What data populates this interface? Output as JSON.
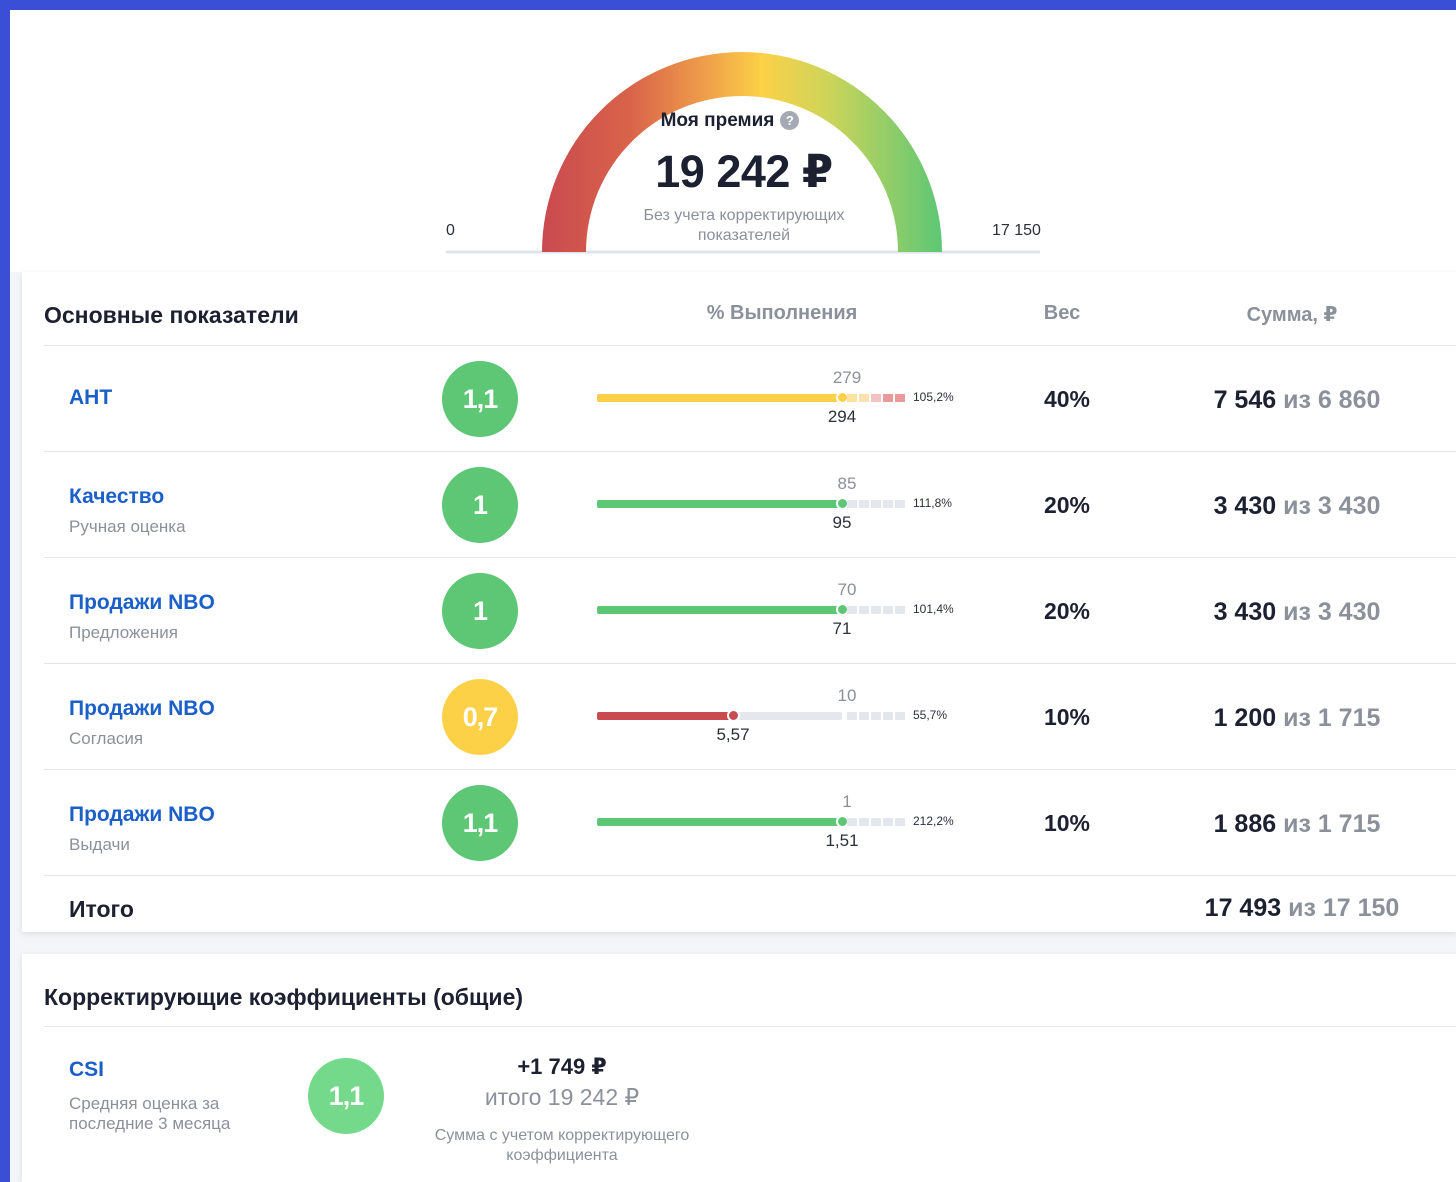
{
  "gauge": {
    "title": "Моя премия",
    "help_icon": "?",
    "value": "19 242 ₽",
    "note": "Без учета корректирующих показателей",
    "min_label": "0",
    "max_label": "17 150",
    "colors": [
      "#c94a4f",
      "#fcd147",
      "#5dc775"
    ]
  },
  "main": {
    "title": "Основные показатели",
    "headers": {
      "completion": "% Выполнения",
      "weight": "Вес",
      "sum": "Сумма, ₽"
    },
    "rows": [
      {
        "name": "АНТ",
        "sub": "",
        "coef": "1,1",
        "coef_color": "green",
        "plan": "279",
        "fact": "294",
        "pct": "105,2%",
        "fill": 1.0,
        "bar_color": "#fcd147",
        "weight": "40%",
        "sum": "7 546",
        "of": "из 6 860",
        "overflow": "red"
      },
      {
        "name": "Качество",
        "sub": "Ручная оценка",
        "coef": "1",
        "coef_color": "green",
        "plan": "85",
        "fact": "95",
        "pct": "111,8%",
        "fill": 1.0,
        "bar_color": "#5dc775",
        "weight": "20%",
        "sum": "3 430",
        "of": "из 3 430",
        "overflow": "grey"
      },
      {
        "name": "Продажи NBO",
        "sub": "Предложения",
        "coef": "1",
        "coef_color": "green",
        "plan": "70",
        "fact": "71",
        "pct": "101,4%",
        "fill": 1.0,
        "bar_color": "#5dc775",
        "weight": "20%",
        "sum": "3 430",
        "of": "из 3 430",
        "overflow": "grey"
      },
      {
        "name": "Продажи NBO",
        "sub": "Согласия",
        "coef": "0,7",
        "coef_color": "yellow",
        "plan": "10",
        "fact": "5,57",
        "pct": "55,7%",
        "fill": 0.557,
        "bar_color": "#c94a4f",
        "weight": "10%",
        "sum": "1 200",
        "of": "из 1 715",
        "overflow": "grey"
      },
      {
        "name": "Продажи NBO",
        "sub": "Выдачи",
        "coef": "1,1",
        "coef_color": "green",
        "plan": "1",
        "fact": "1,51",
        "pct": "212,2%",
        "fill": 1.0,
        "bar_color": "#5dc775",
        "weight": "10%",
        "sum": "1 886",
        "of": "из 1 715",
        "overflow": "grey"
      }
    ],
    "total_label": "Итого",
    "total_sum": "17 493",
    "total_of": "из 17 150"
  },
  "corrections": {
    "title": "Корректирующие коэффициенты (общие)",
    "item": {
      "name": "CSI",
      "sub": "Средняя оценка за последние 3 месяца",
      "coef": "1,1",
      "plus": "+1 749 ₽",
      "itogo": "итого 19 242 ₽",
      "note": "Сумма с учетом корректирующего коэффициента"
    }
  }
}
